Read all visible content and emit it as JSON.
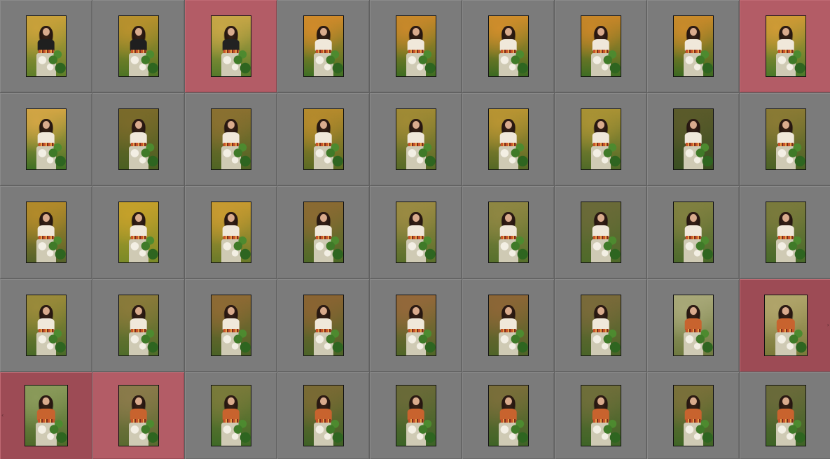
{
  "app": {
    "view": "grid"
  },
  "colors": {
    "cell_bg": "#7b7b7b",
    "cell_selected": "#b35c66",
    "cell_active": "#9d4b55",
    "grid_line": "#5f5f5f"
  },
  "grid": {
    "columns": 9,
    "rows": 5,
    "nav_icons": {
      "next": "chevron-right-icon",
      "prev": "chevron-left-icon"
    },
    "cells": [
      {
        "state": "normal",
        "scene": "autumn",
        "top": "#1f1f1f",
        "bg_a": "#c9a13a",
        "bg_b": "#5f7f2a"
      },
      {
        "state": "normal",
        "scene": "autumn",
        "top": "#1f1f1f",
        "bg_a": "#b8912d",
        "bg_b": "#4d7425"
      },
      {
        "state": "selected",
        "scene": "autumn",
        "top": "#222222",
        "bg_a": "#c7a646",
        "bg_b": "#557a2a"
      },
      {
        "state": "normal",
        "scene": "wide",
        "top": "#f0e8da",
        "bg_a": "#d08a2a",
        "bg_b": "#3f7025"
      },
      {
        "state": "normal",
        "scene": "wide",
        "top": "#f0e8da",
        "bg_a": "#c8882a",
        "bg_b": "#3e6d22"
      },
      {
        "state": "normal",
        "scene": "wide",
        "top": "#f0e8da",
        "bg_a": "#cf8d2b",
        "bg_b": "#3b6a22"
      },
      {
        "state": "normal",
        "scene": "wide",
        "top": "#f0e8da",
        "bg_a": "#c88628",
        "bg_b": "#3e6d24"
      },
      {
        "state": "normal",
        "scene": "wide",
        "top": "#f0e8da",
        "bg_a": "#c98a2a",
        "bg_b": "#3c6a22"
      },
      {
        "state": "selected",
        "scene": "wide",
        "top": "#f0e8da",
        "bg_a": "#cf9a35",
        "bg_b": "#4a7a2a"
      },
      {
        "state": "normal",
        "scene": "wide",
        "top": "#f0e8da",
        "bg_a": "#d2a544",
        "bg_b": "#3f7025"
      },
      {
        "state": "normal",
        "scene": "close",
        "top": "#f0e8da",
        "bg_a": "#7a6a2a",
        "bg_b": "#4a5f22"
      },
      {
        "state": "normal",
        "scene": "close",
        "top": "#f0e8da",
        "bg_a": "#8a7030",
        "bg_b": "#4f6424"
      },
      {
        "state": "normal",
        "scene": "close",
        "top": "#f0e8da",
        "bg_a": "#b58a2c",
        "bg_b": "#5a6a24"
      },
      {
        "state": "normal",
        "scene": "close",
        "top": "#f0e8da",
        "bg_a": "#a08a34",
        "bg_b": "#566a28"
      },
      {
        "state": "normal",
        "scene": "close",
        "top": "#f0e8da",
        "bg_a": "#b89432",
        "bg_b": "#546826"
      },
      {
        "state": "normal",
        "scene": "close",
        "top": "#f0e8da",
        "bg_a": "#a99234",
        "bg_b": "#4f6a28"
      },
      {
        "state": "normal",
        "scene": "close",
        "top": "#f0e8da",
        "bg_a": "#5a5a2a",
        "bg_b": "#3a4f22"
      },
      {
        "state": "normal",
        "scene": "close",
        "top": "#f0e8da",
        "bg_a": "#8a7a34",
        "bg_b": "#4a6226"
      },
      {
        "state": "normal",
        "scene": "close",
        "top": "#f0e8da",
        "bg_a": "#b28a2a",
        "bg_b": "#54622a"
      },
      {
        "state": "normal",
        "scene": "close",
        "top": "#f0e8da",
        "bg_a": "#c4a02a",
        "bg_b": "#7a8a28"
      },
      {
        "state": "normal",
        "scene": "close",
        "top": "#f0e8da",
        "bg_a": "#c79a30",
        "bg_b": "#6a7a2a"
      },
      {
        "state": "normal",
        "scene": "close",
        "top": "#f0e8da",
        "bg_a": "#8a6a32",
        "bg_b": "#4f6a28"
      },
      {
        "state": "normal",
        "scene": "close",
        "top": "#f0e8da",
        "bg_a": "#9a8a42",
        "bg_b": "#5a6f2c"
      },
      {
        "state": "normal",
        "scene": "close",
        "top": "#f0e8da",
        "bg_a": "#8e8642",
        "bg_b": "#56702c"
      },
      {
        "state": "normal",
        "scene": "close",
        "top": "#f0e8da",
        "bg_a": "#6a6a38",
        "bg_b": "#4f6a2a"
      },
      {
        "state": "normal",
        "scene": "close",
        "top": "#f0e8da",
        "bg_a": "#808040",
        "bg_b": "#4d6a2c"
      },
      {
        "state": "normal",
        "scene": "close",
        "top": "#f0e8da",
        "bg_a": "#7a7a3c",
        "bg_b": "#486a2a"
      },
      {
        "state": "normal",
        "scene": "close",
        "top": "#f0e8da",
        "bg_a": "#9a8a3a",
        "bg_b": "#4a6a28"
      },
      {
        "state": "normal",
        "scene": "close",
        "top": "#f0e8da",
        "bg_a": "#8a7a3a",
        "bg_b": "#4f6c2a"
      },
      {
        "state": "normal",
        "scene": "close",
        "top": "#f0e8da",
        "bg_a": "#8e6a34",
        "bg_b": "#4a6226"
      },
      {
        "state": "normal",
        "scene": "close",
        "top": "#f0e8da",
        "bg_a": "#8a6432",
        "bg_b": "#4c6428"
      },
      {
        "state": "normal",
        "scene": "close",
        "top": "#f0e8da",
        "bg_a": "#93683a",
        "bg_b": "#506628"
      },
      {
        "state": "normal",
        "scene": "close",
        "top": "#f0e8da",
        "bg_a": "#8c6636",
        "bg_b": "#4f6428"
      },
      {
        "state": "normal",
        "scene": "close",
        "top": "#f0e8da",
        "bg_a": "#7a6a3a",
        "bg_b": "#4a6428"
      },
      {
        "state": "normal",
        "scene": "close",
        "top": "#c8632e",
        "bg_a": "#a8a878",
        "bg_b": "#6f7a40"
      },
      {
        "state": "active",
        "scene": "close",
        "top": "#c8632e",
        "bg_a": "#b0a46a",
        "bg_b": "#7a7a3a",
        "nav": "right"
      },
      {
        "state": "active",
        "scene": "close",
        "top": "#c8632e",
        "bg_a": "#8a9a5a",
        "bg_b": "#4f6a2a",
        "nav": "left"
      },
      {
        "state": "selected",
        "scene": "close",
        "top": "#c8632e",
        "bg_a": "#8a7a4a",
        "bg_b": "#5a6a30"
      },
      {
        "state": "normal",
        "scene": "close",
        "top": "#c8632e",
        "bg_a": "#7a7a3a",
        "bg_b": "#3f6a26"
      },
      {
        "state": "normal",
        "scene": "close",
        "top": "#c8632e",
        "bg_a": "#7a6a34",
        "bg_b": "#3f6226"
      },
      {
        "state": "normal",
        "scene": "close",
        "top": "#c8632e",
        "bg_a": "#6a6a38",
        "bg_b": "#3c6426"
      },
      {
        "state": "normal",
        "scene": "close",
        "top": "#c8632e",
        "bg_a": "#7a6e3a",
        "bg_b": "#3f6426"
      },
      {
        "state": "normal",
        "scene": "close",
        "top": "#c8632e",
        "bg_a": "#6f6e3a",
        "bg_b": "#3e6426"
      },
      {
        "state": "normal",
        "scene": "close",
        "top": "#c8632e",
        "bg_a": "#7a703a",
        "bg_b": "#406626"
      },
      {
        "state": "normal",
        "scene": "close",
        "top": "#c8632e",
        "bg_a": "#6a6a3a",
        "bg_b": "#3e6426"
      }
    ]
  }
}
